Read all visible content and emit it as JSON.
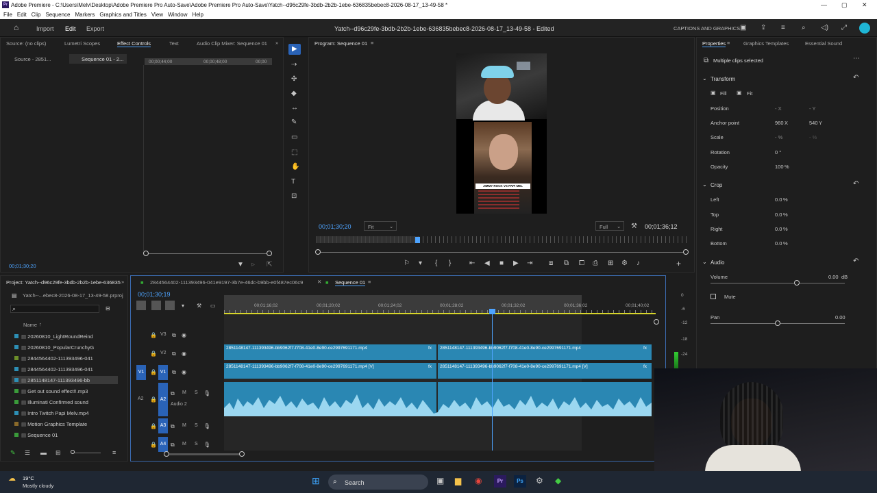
{
  "window": {
    "title": "Adobe Premiere - C:\\Users\\Melv\\Desktop\\Adobe Premiere Pro Auto-Save\\Adobe Premiere Pro Auto-Save\\Yatch--d96c29fe-3bdb-2b2b-1ebe-636835bebec8-2026-08-17_13-49-58 *",
    "min": "—",
    "max": "▢",
    "close": "✕"
  },
  "menu": [
    "File",
    "Edit",
    "Clip",
    "Sequence",
    "Markers",
    "Graphics and Titles",
    "View",
    "Window",
    "Help"
  ],
  "appbar": {
    "import": "Import",
    "edit": "Edit",
    "export": "Export",
    "doc_title": "Yatch--d96c29fe-3bdb-2b2b-1ebe-636835bebec8-2026-08-17_13-49-58 - Edited",
    "captions": "CAPTIONS AND GRAPHICS"
  },
  "source_panel": {
    "tabs": [
      "Source: (no clips)",
      "Lumetri Scopes",
      "Effect Controls",
      "Text",
      "Audio Clip Mixer: Sequence 01"
    ],
    "subtabs": [
      "Source - 2851...",
      "Sequence 01 - 2..."
    ],
    "time1": "00;00;44;00",
    "time2": "00;00;48;00",
    "time3": "00;00",
    "timecode": "00;01;30;20"
  },
  "program": {
    "title": "Program: Sequence 01",
    "timecode": "00;01;30;20",
    "fit": "Fit",
    "full": "Full",
    "duration": "00;01;36;12",
    "caption_text": "JIMMY ROCK VS PAPI MEL"
  },
  "project": {
    "title": "Project: Yatch--d96c29fe-3bdb-2b2b-1ebe-636835",
    "file": "Yatch--...ebec8-2026-08-17_13-49-58.prproj",
    "col_name": "Name",
    "items": [
      {
        "name": "20260810_LightRoundReind",
        "color": "#2d8fb5"
      },
      {
        "name": "20260810_PopularCrunchyG",
        "color": "#2d8fb5"
      },
      {
        "name": "2844564402-111393496-041",
        "color": "#6d8f2a"
      },
      {
        "name": "2844564402-111393496-041",
        "color": "#2d8fb5"
      },
      {
        "name": "2851148147-111393496-bb",
        "color": "#2d8fb5"
      },
      {
        "name": "Get out sound effect!!.mp3",
        "color": "#3a9b3a"
      },
      {
        "name": "Illuminati Confirmed sound",
        "color": "#3a9b3a"
      },
      {
        "name": "Intro Twitch Papi Melv.mp4",
        "color": "#2d8fb5"
      },
      {
        "name": "Motion Graphics Template",
        "color": "#8a6a2a"
      },
      {
        "name": "Sequence 01",
        "color": "#3a9b3a"
      }
    ]
  },
  "timeline": {
    "tab1": "2844564402-111393496-041e9197-3b7e-46dc-b9bb-e0f487ec06c9",
    "tab2": "Sequence 01",
    "timecode": "00;01;30;19",
    "ruler": [
      "00;01;16;02",
      "00;01;20;02",
      "00;01;24;02",
      "00;01;28;02",
      "00;01;32;02",
      "00;01;36;02",
      "00;01;40;02"
    ],
    "tracks": [
      "V3",
      "V2",
      "V1",
      "A2",
      "A3",
      "A4"
    ],
    "audio2": "Audio 2",
    "clip_v2_a": "2851148147-111393496-bb9062f7-f708-41e0-8e90-ce2997691171.mp4",
    "clip_v2_b": "2851148147-111393496-bb9062f7-f708-41e0-8e90-ce2997691171.mp4",
    "clip_v1_a": "2851148147-111393496-bb9062f7-f708-41e0-8e90-ce2997691171.mp4 [V]",
    "clip_v1_b": "2851148147-111393496-bb9062f7-f708-41e0-8e90-ce2997691171.mp4 [V]",
    "meter": [
      "0",
      "-6",
      "-12",
      "-18",
      "-24"
    ]
  },
  "properties": {
    "tabs": [
      "Properties",
      "Graphics Templates",
      "Essential Sound"
    ],
    "selection": "Multiple clips selected",
    "transform": "Transform",
    "fill": "Fill",
    "fit": "Fit",
    "position": "Position",
    "pos_x": "- X",
    "pos_y": "- Y",
    "anchor": "Anchor point",
    "anchor_x": "960",
    "anchor_y": "540",
    "x_lbl": "X",
    "y_lbl": "Y",
    "scale": "Scale",
    "scale_val": "- %",
    "scale_val2": "- %",
    "rotation": "Rotation",
    "rotation_val": "0 °",
    "opacity": "Opacity",
    "opacity_val": "100",
    "pct": "%",
    "crop": "Crop",
    "left": "Left",
    "top": "Top",
    "right": "Right",
    "bottom": "Bottom",
    "crop_val": "0.0",
    "audio": "Audio",
    "volume": "Volume",
    "volume_val": "0.00",
    "db": "dB",
    "mute": "Mute",
    "pan": "Pan",
    "pan_val": "0.00"
  },
  "taskbar": {
    "temp": "19°C",
    "weather": "Mostly cloudy",
    "search": "Search"
  }
}
